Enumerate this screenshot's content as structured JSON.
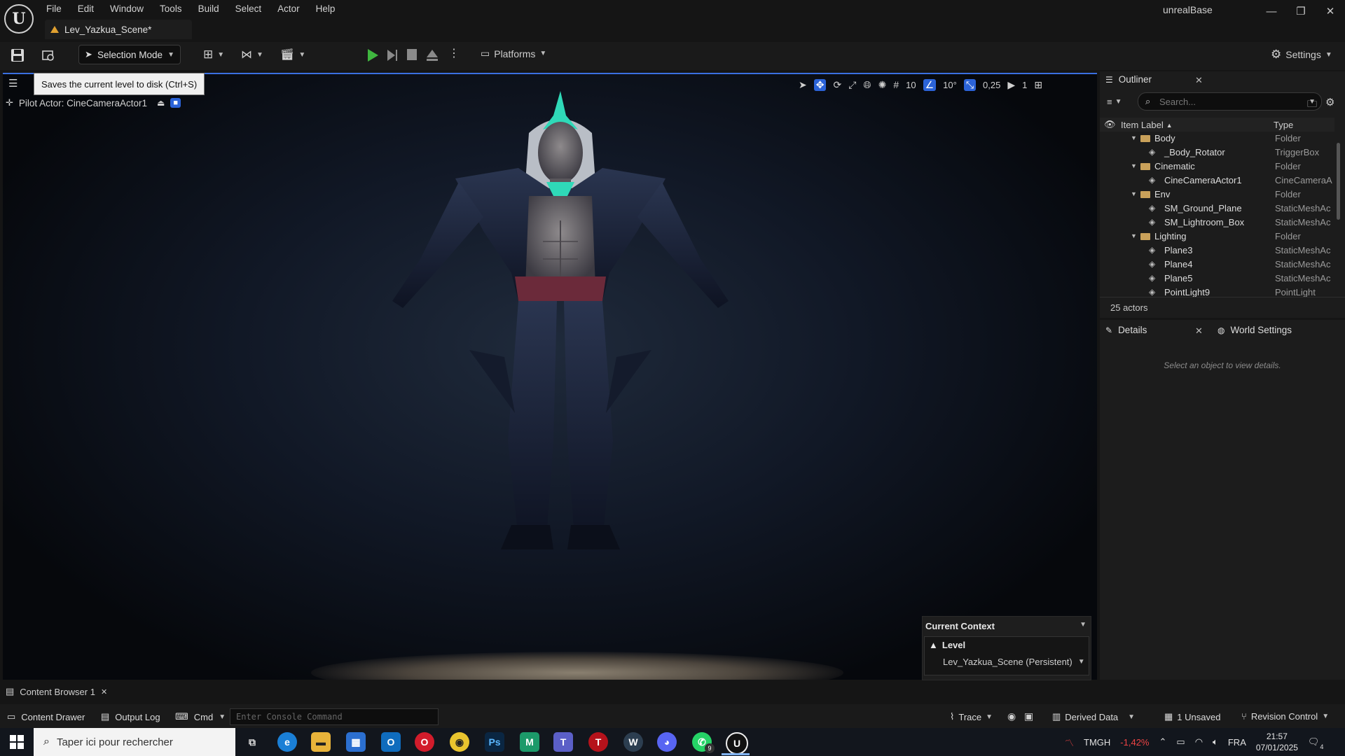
{
  "app": {
    "logo": "U",
    "project_name": "unrealBase",
    "menu": [
      "File",
      "Edit",
      "Window",
      "Tools",
      "Build",
      "Select",
      "Actor",
      "Help"
    ],
    "doc_tab": "Lev_Yazkua_Scene*",
    "window_controls": [
      "—",
      "❐",
      "✕"
    ]
  },
  "toolbar": {
    "selection_mode": "Selection Mode",
    "platforms": "Platforms",
    "settings": "Settings"
  },
  "tooltip": "Saves the current level to disk (Ctrl+S)",
  "viewport": {
    "pilot_actor": "Pilot Actor: CineCameraActor1",
    "grid_snap": "10",
    "rotation_snap": "10°",
    "scale_snap": "0,25",
    "camera_speed": "1"
  },
  "context": {
    "header": "Current Context",
    "level_label": "Level",
    "level_value": "Lev_Yazkua_Scene (Persistent)"
  },
  "outliner": {
    "title": "Outliner",
    "search_placeholder": "Search...",
    "col_label": "Item Label",
    "col_type": "Type",
    "rows": [
      {
        "label": "Body",
        "type": "Folder",
        "kind": "folder",
        "indent": 1
      },
      {
        "label": "_Body_Rotator",
        "type": "TriggerBox",
        "kind": "actor",
        "indent": 2
      },
      {
        "label": "Cinematic",
        "type": "Folder",
        "kind": "folder",
        "indent": 1
      },
      {
        "label": "CineCameraActor1",
        "type": "CineCameraA",
        "kind": "actor",
        "indent": 2
      },
      {
        "label": "Env",
        "type": "Folder",
        "kind": "folder",
        "indent": 1
      },
      {
        "label": "SM_Ground_Plane",
        "type": "StaticMeshAc",
        "kind": "actor",
        "indent": 2
      },
      {
        "label": "SM_Lightroom_Box",
        "type": "StaticMeshAc",
        "kind": "actor",
        "indent": 2
      },
      {
        "label": "Lighting",
        "type": "Folder",
        "kind": "folder",
        "indent": 1
      },
      {
        "label": "Plane3",
        "type": "StaticMeshAc",
        "kind": "actor",
        "indent": 2
      },
      {
        "label": "Plane4",
        "type": "StaticMeshAc",
        "kind": "actor",
        "indent": 2
      },
      {
        "label": "Plane5",
        "type": "StaticMeshAc",
        "kind": "actor",
        "indent": 2
      },
      {
        "label": "PointLight9",
        "type": "PointLight",
        "kind": "actor",
        "indent": 2
      }
    ],
    "actor_count": "25 actors"
  },
  "details": {
    "tab": "Details",
    "world_tab": "World Settings",
    "empty_text": "Select an object to view details."
  },
  "bottom": {
    "content_browser_tab": "Content Browser 1",
    "content_drawer": "Content Drawer",
    "output_log": "Output Log",
    "cmd": "Cmd",
    "console_placeholder": "Enter Console Command",
    "trace": "Trace",
    "derived_data": "Derived Data",
    "unsaved": "1 Unsaved",
    "revision_control": "Revision Control"
  },
  "taskbar": {
    "search_placeholder": "Taper ici pour rechercher",
    "ticker_name": "TMGH",
    "ticker_value": "-1,42%",
    "language": "FRA",
    "time": "21:57",
    "date": "07/01/2025",
    "notifications": "4",
    "whatsapp_badge": "9"
  },
  "colors": {
    "accent_blue": "#2b63d8",
    "play_green": "#3fb63f",
    "folder": "#c9a15a"
  }
}
